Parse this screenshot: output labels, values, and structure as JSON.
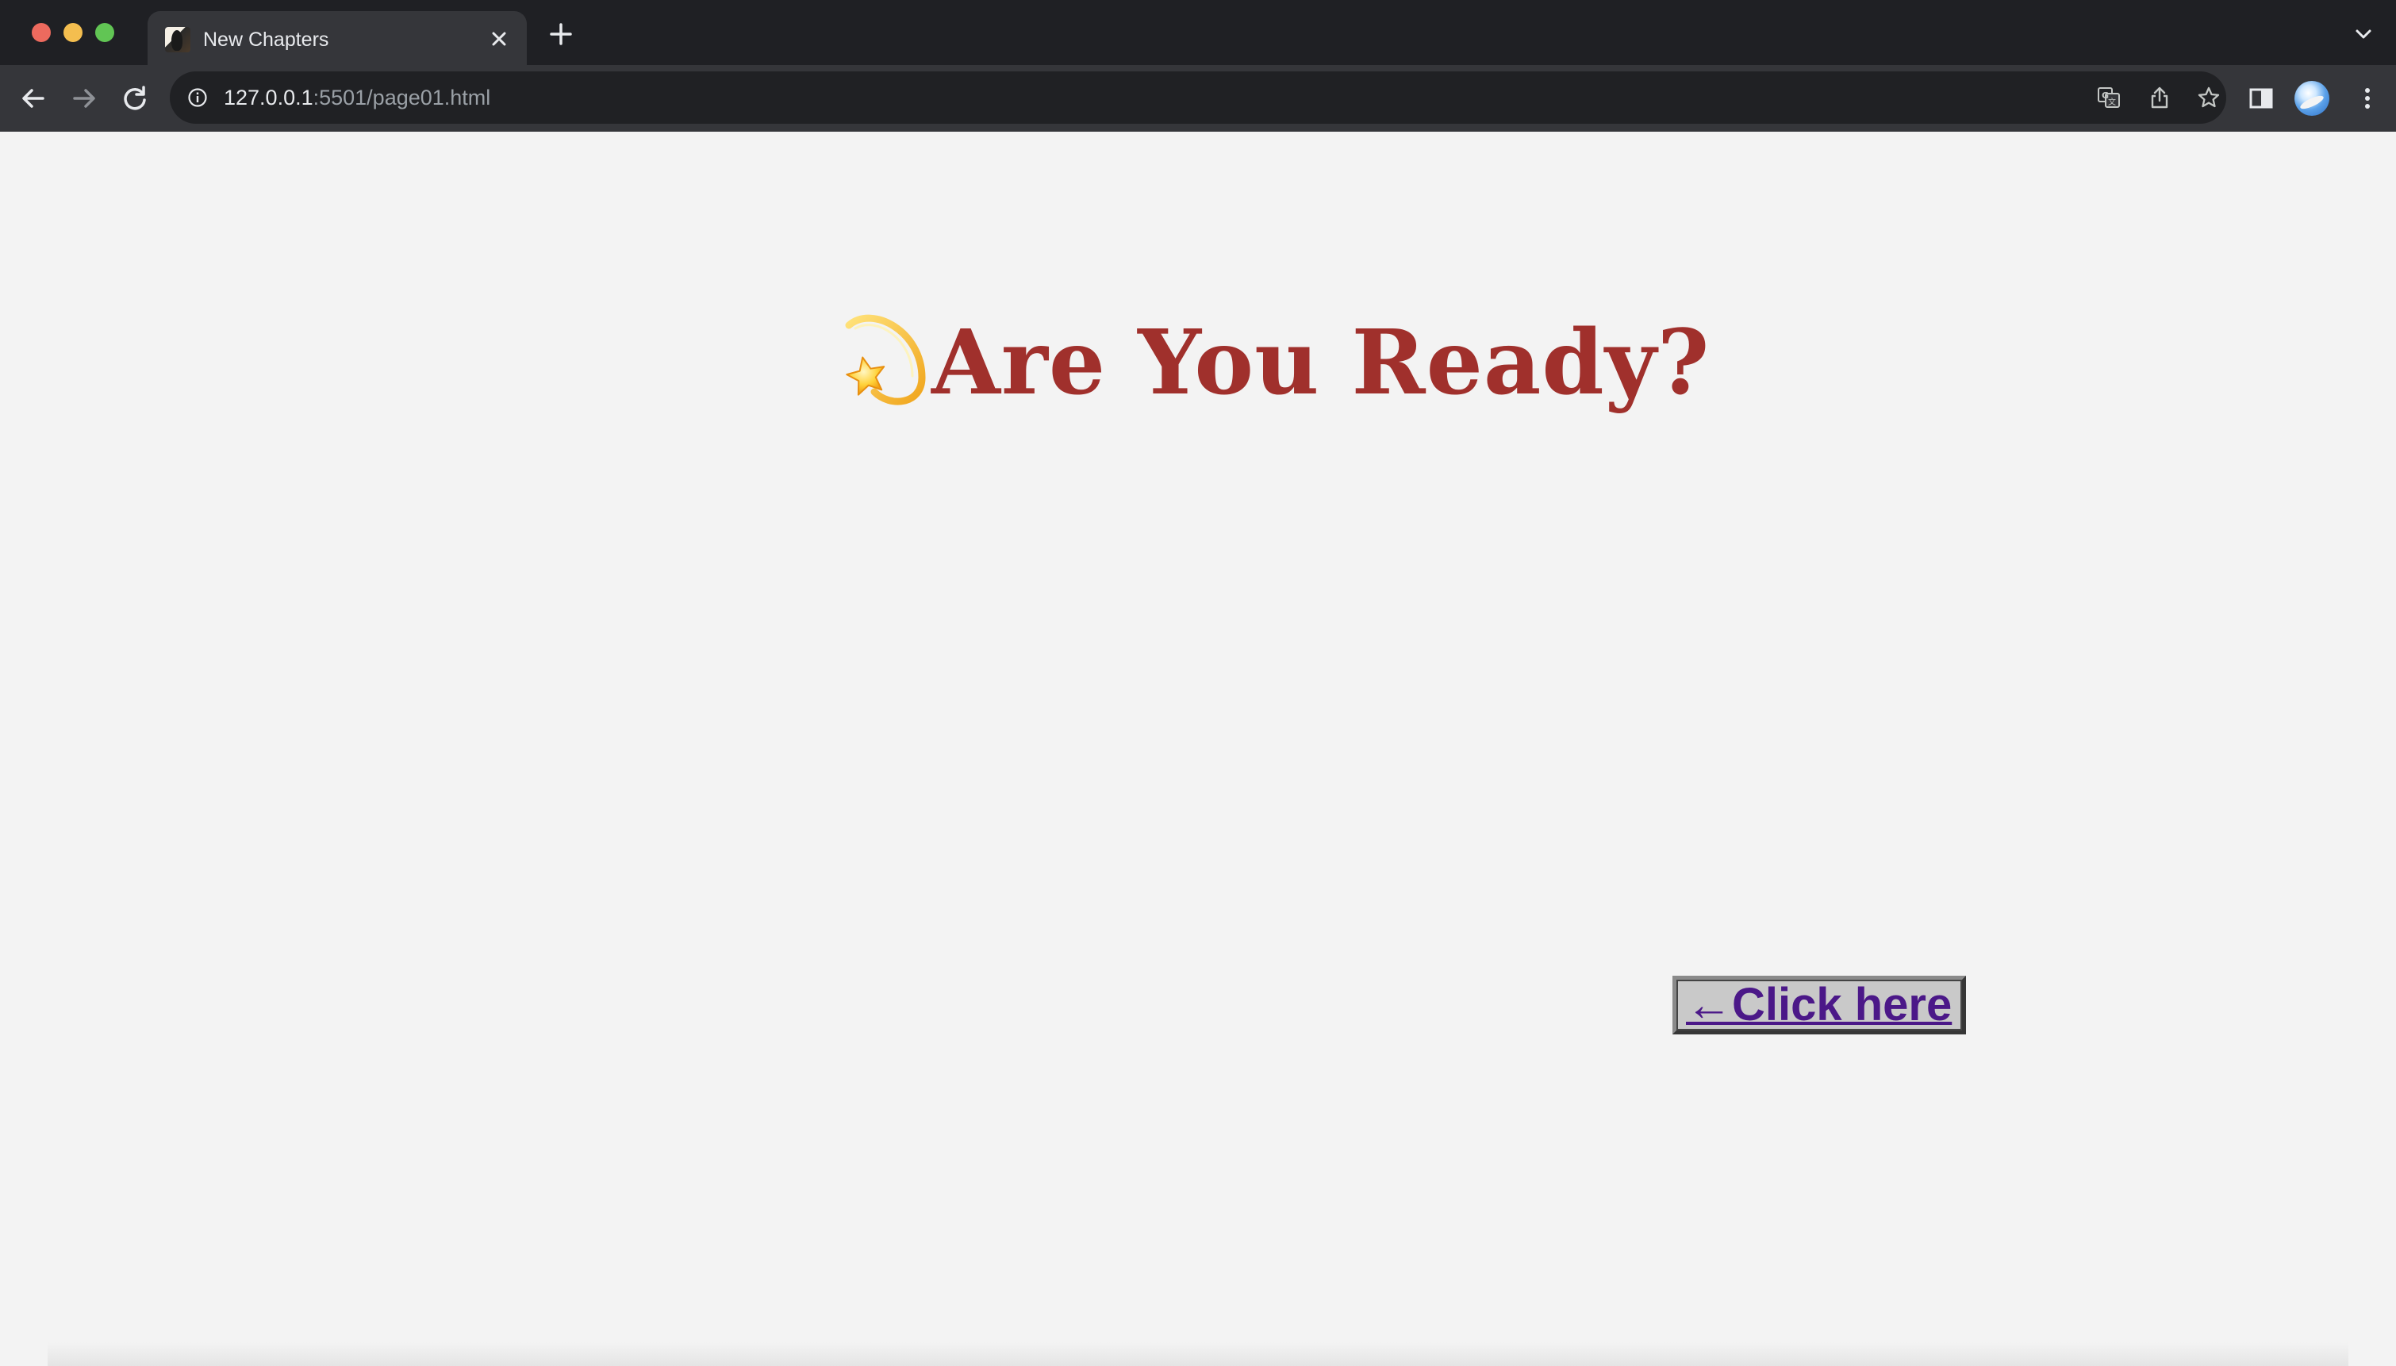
{
  "browser": {
    "tab": {
      "title": "New Chapters",
      "favicon": "book-cover-icon",
      "close_icon": "close-icon"
    },
    "new_tab_icon": "plus-icon",
    "tab_search_icon": "chevron-down-icon",
    "nav": {
      "back_icon": "arrow-left-icon",
      "forward_icon": "arrow-right-icon",
      "reload_icon": "reload-icon"
    },
    "address_bar": {
      "info_icon": "info-icon",
      "url_host": "127.0.0.1",
      "url_rest": ":5501/page01.html",
      "translate_icon": "translate-icon",
      "share_icon": "share-icon",
      "bookmark_icon": "star-icon"
    },
    "toolbar_icons": {
      "side_panel": "side-panel-icon",
      "profile": "avatar",
      "menu": "kebab-menu-icon"
    }
  },
  "page": {
    "heading_emoji": "dizzy-star-icon",
    "heading": "Are You Ready?",
    "link_label": "←Click here"
  },
  "colors": {
    "heading": "#a0302c",
    "link": "#4b1888",
    "page_background": "#f3f3f3",
    "tabstrip": "#1f2024",
    "toolbar": "#35363a"
  }
}
